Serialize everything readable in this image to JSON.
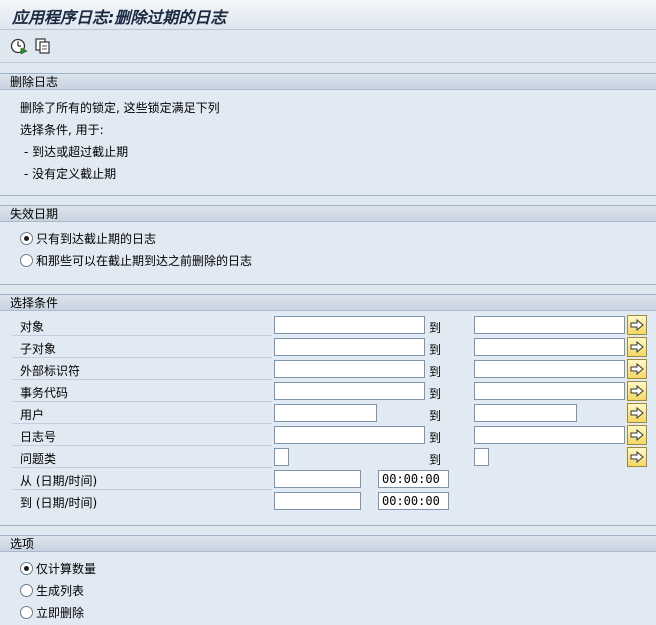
{
  "window": {
    "title": "应用程序日志:删除过期的日志"
  },
  "toolbar": {
    "buttons": [
      {
        "icon": "execute-clock-icon"
      },
      {
        "icon": "copy-variant-icon"
      }
    ]
  },
  "section_delete": {
    "header": "删除日志",
    "lines": [
      "删除了所有的锁定, 这些锁定满足下列",
      "选择条件, 用于:",
      " - 到达或超过截止期",
      " - 没有定义截止期"
    ]
  },
  "section_expiry": {
    "header": "失效日期",
    "options": [
      {
        "label": "只有到达截止期的日志",
        "selected": true
      },
      {
        "label": "和那些可以在截止期到达之前删除的日志",
        "selected": false
      }
    ]
  },
  "section_selection": {
    "header": "选择条件",
    "to_label": "到",
    "rows": [
      {
        "label": "对象",
        "from": "",
        "to": ""
      },
      {
        "label": "子对象",
        "from": "",
        "to": ""
      },
      {
        "label": "外部标识符",
        "from": "",
        "to": ""
      },
      {
        "label": "事务代码",
        "from": "",
        "to": ""
      },
      {
        "label": "用户",
        "from": "",
        "to": ""
      },
      {
        "label": "日志号",
        "from": "",
        "to": ""
      },
      {
        "label": "问题类",
        "from": "",
        "to": ""
      }
    ],
    "date_rows": [
      {
        "label": "从 (日期/时间)",
        "date": "",
        "time": "00:00:00"
      },
      {
        "label": "到 (日期/时间)",
        "date": "",
        "time": "00:00:00"
      }
    ]
  },
  "section_options": {
    "header": "选项",
    "options": [
      {
        "label": "仅计算数量",
        "selected": true
      },
      {
        "label": "生成列表",
        "selected": false
      },
      {
        "label": "立即删除",
        "selected": false
      }
    ]
  },
  "colors": {
    "background": "#dfe7f0",
    "more_button": "#f3d865",
    "border": "#9fb1c6"
  }
}
